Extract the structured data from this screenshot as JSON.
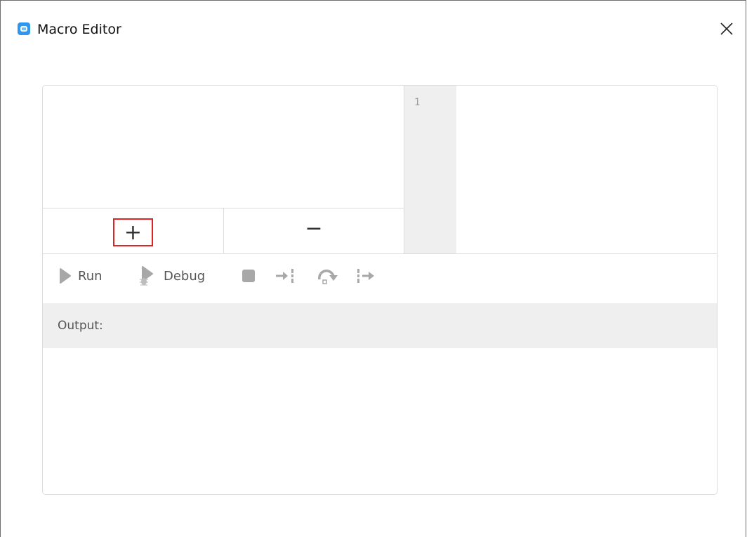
{
  "window": {
    "title": "Macro Editor",
    "app_icon": "chat-bubble-icon",
    "close_icon": "close-icon"
  },
  "macro_list": {
    "items": [],
    "add_label": "+",
    "remove_label": "−"
  },
  "editor": {
    "line_numbers": [
      "1"
    ],
    "content": ""
  },
  "toolbar": {
    "run_label": "Run",
    "debug_label": "Debug",
    "icons": [
      "play-icon",
      "debug-icon",
      "stop-icon",
      "step-into-icon",
      "step-over-icon",
      "step-out-icon"
    ]
  },
  "output": {
    "label": "Output:",
    "content": ""
  },
  "colors": {
    "accent": "#2f97ee",
    "highlight_border": "#e02424",
    "disabled_icon": "#a8a8a8",
    "gutter_bg": "#efefef",
    "output_header_bg": "#efefef"
  }
}
